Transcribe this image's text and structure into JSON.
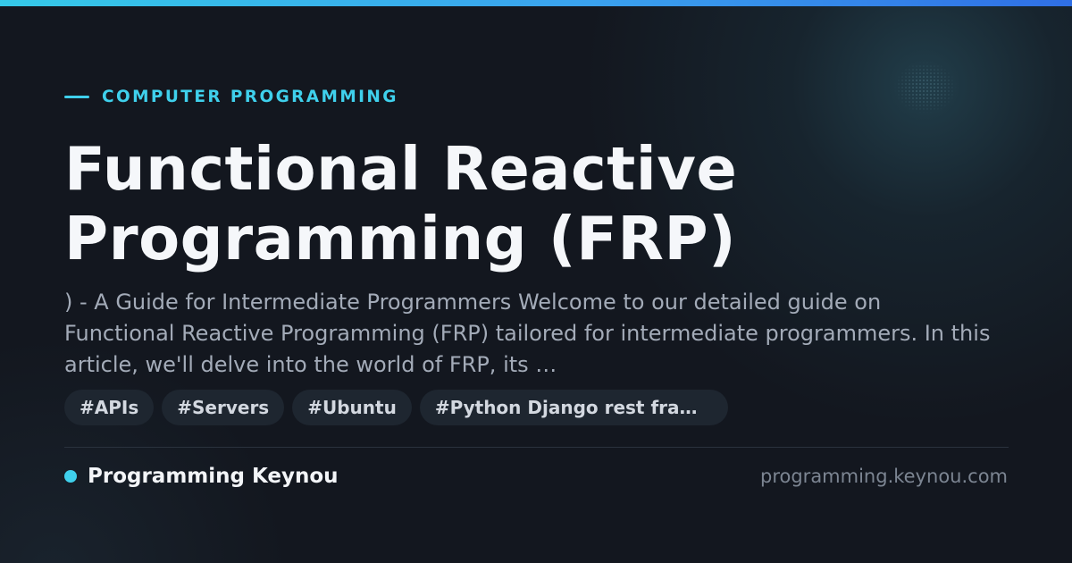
{
  "card": {
    "category": "COMPUTER PROGRAMMING",
    "title": "Functional Reactive Programming (FRP)",
    "description": ") - A Guide for Intermediate Programmers Welcome to our detailed guide on Functional Reactive Programming (FRP) tailored for intermediate programmers. In this article, we'll delve into the world of FRP, its …",
    "tags": [
      "#APIs",
      "#Servers",
      "#Ubuntu",
      "#Python Django rest fram…"
    ],
    "site_name": "Programming Keynou",
    "site_url": "programming.keynou.com"
  },
  "colors": {
    "background": "#13171f",
    "accent": "#3fd0ec",
    "title": "#f5f7fa",
    "description": "#a3abb8",
    "tag_background": "#1e2630",
    "url": "#7c8592"
  }
}
